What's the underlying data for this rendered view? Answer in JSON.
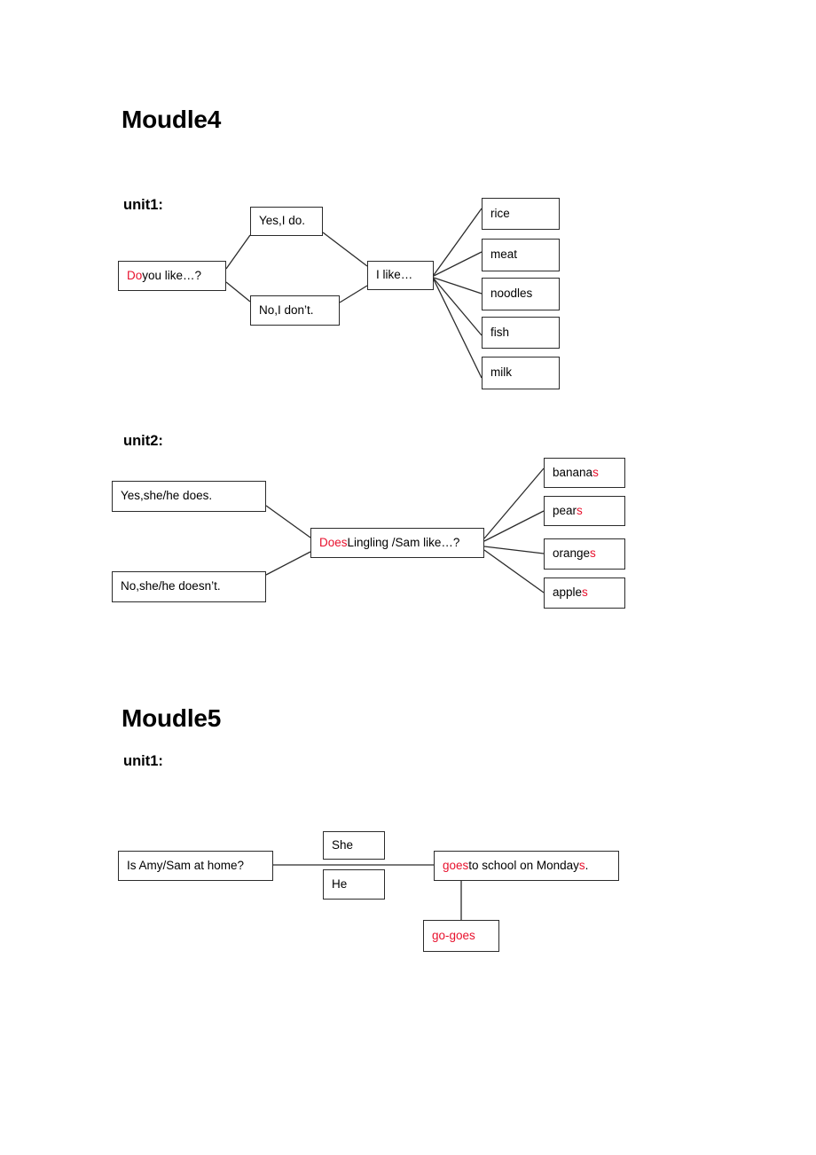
{
  "document": {
    "title": "Moudle4",
    "modules": [
      {
        "heading": "Moudle4",
        "units": [
          {
            "label": "unit1:",
            "question": {
              "red_prefix": "Do",
              "rest": " you like…?"
            },
            "answers": [
              "Yes,I do.",
              "No,I don’t."
            ],
            "response": "I like…",
            "items": [
              "rice",
              "meat",
              "noodles",
              "fish",
              "milk"
            ]
          },
          {
            "label": "unit2:",
            "question": {
              "red_prefix": "Does",
              "rest": " Lingling /Sam like…?"
            },
            "answers": [
              "Yes,she/he does.",
              "No,she/he doesn’t."
            ],
            "items": [
              {
                "stem": "banana",
                "red_suffix": "s"
              },
              {
                "stem": "pear",
                "red_suffix": "s"
              },
              {
                "stem": "orange",
                "red_suffix": "s"
              },
              {
                "stem": "apple",
                "red_suffix": "s"
              }
            ]
          }
        ]
      },
      {
        "heading": "Moudle5",
        "units": [
          {
            "label": "unit1:",
            "question": "Is Amy/Sam at home?",
            "subjects": [
              "She",
              "He"
            ],
            "predicate": {
              "red_prefix": "goes",
              "middle": " to school on Monday",
              "red_suffix": "s",
              "tail": "."
            },
            "note": "go-goes"
          }
        ]
      }
    ]
  },
  "colors": {
    "accent_red": "#e8112d",
    "border": "#2b2b2b",
    "text": "#000000",
    "background": "#ffffff"
  }
}
